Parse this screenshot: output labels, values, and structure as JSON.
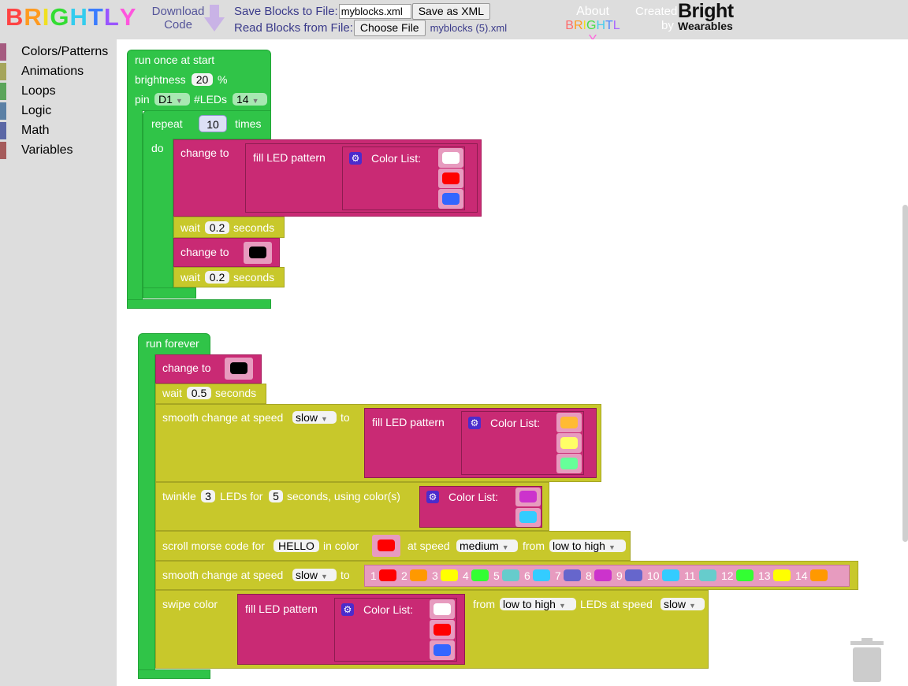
{
  "header": {
    "logo_letters": [
      {
        "ch": "B",
        "color": "#ff4444"
      },
      {
        "ch": "R",
        "color": "#ff9a1f"
      },
      {
        "ch": "I",
        "color": "#f0e020"
      },
      {
        "ch": "G",
        "color": "#33dd33"
      },
      {
        "ch": "H",
        "color": "#33ccee"
      },
      {
        "ch": "T",
        "color": "#3a7cff"
      },
      {
        "ch": "L",
        "color": "#9a55ff"
      },
      {
        "ch": "Y",
        "color": "#ff55dd"
      }
    ],
    "download_line1": "Download",
    "download_line2": "Code",
    "save_label": "Save Blocks to File:",
    "filename_value": "myblocks.xml",
    "save_button": "Save as XML",
    "read_label": "Read Blocks from File:",
    "choose_button": "Choose File",
    "chosen_file": "myblocks (5).xml",
    "about_line1": "About",
    "about_letters": [
      {
        "ch": "B",
        "color": "#ff6b6b"
      },
      {
        "ch": "R",
        "color": "#ff9a1f"
      },
      {
        "ch": "I",
        "color": "#f0e020"
      },
      {
        "ch": "G",
        "color": "#44dd44"
      },
      {
        "ch": "H",
        "color": "#44ccee"
      },
      {
        "ch": "T",
        "color": "#4a88ff"
      },
      {
        "ch": "L",
        "color": "#aa66ff"
      },
      {
        "ch": "Y",
        "color": "#ff66dd"
      }
    ],
    "created_line1": "Created",
    "created_line2": "by",
    "brand_line1": "Bright",
    "brand_line2": "Wearables"
  },
  "toolbox": {
    "categories": [
      {
        "label": "Colors/Patterns",
        "color": "#a55b80"
      },
      {
        "label": "Animations",
        "color": "#a5a55b"
      },
      {
        "label": "Loops",
        "color": "#5ba55b"
      },
      {
        "label": "Logic",
        "color": "#5b80a5"
      },
      {
        "label": "Math",
        "color": "#5b67a5"
      },
      {
        "label": "Variables",
        "color": "#a55b5b"
      }
    ]
  },
  "start": {
    "title": "run once at start",
    "brightness_label": "brightness",
    "brightness_value": "20",
    "percent": "%",
    "pin_label": "pin",
    "pin_value": "D1",
    "leds_label": "#LEDs",
    "leds_value": "14",
    "repeat_label": "repeat",
    "repeat_value": "10",
    "times_label": "times",
    "do_label": "do",
    "change_to_label": "change to",
    "fill_label": "fill LED pattern",
    "color_list_label": "Color List:",
    "fill_colors": [
      "#ffffff",
      "#ff0000",
      "#3366ff"
    ],
    "wait_label": "wait",
    "wait1_value": "0.2",
    "seconds_label": "seconds",
    "change2_color": "#000000",
    "wait2_value": "0.2"
  },
  "forever": {
    "title": "run forever",
    "change_to_label": "change to",
    "change_color": "#000000",
    "wait_label": "wait",
    "wait_value": "0.5",
    "seconds_label": "seconds",
    "smooth_label": "smooth change at speed",
    "smooth_speed": "slow",
    "to_label": "to",
    "fill_label": "fill LED pattern",
    "color_list_label": "Color List:",
    "smooth_colors": [
      "#ffbb33",
      "#ffff66",
      "#66ff99"
    ],
    "twinkle_label1": "twinkle",
    "twinkle_count": "3",
    "twinkle_label2": "LEDs for",
    "twinkle_secs": "5",
    "twinkle_label3": "seconds, using color(s)",
    "twinkle_colors": [
      "#cc33cc",
      "#33ccff"
    ],
    "morse_label": "scroll morse code for",
    "morse_text": "HELLO",
    "morse_in_color": "in color",
    "morse_color": "#ff0000",
    "at_speed_label": "at speed",
    "morse_speed": "medium",
    "from_label": "from",
    "morse_dir": "low to high",
    "smooth2_label": "smooth change at speed",
    "smooth2_speed": "slow",
    "smooth2_to": "to",
    "led_list": [
      {
        "n": "1",
        "color": "#ff0000"
      },
      {
        "n": "2",
        "color": "#ff9900"
      },
      {
        "n": "3",
        "color": "#ffff00"
      },
      {
        "n": "4",
        "color": "#33ff33"
      },
      {
        "n": "5",
        "color": "#66cccc"
      },
      {
        "n": "6",
        "color": "#33ccff"
      },
      {
        "n": "7",
        "color": "#6666cc"
      },
      {
        "n": "8",
        "color": "#cc33cc"
      },
      {
        "n": "9",
        "color": "#6666cc"
      },
      {
        "n": "10",
        "color": "#33ccff"
      },
      {
        "n": "11",
        "color": "#66cccc"
      },
      {
        "n": "12",
        "color": "#33ff33"
      },
      {
        "n": "13",
        "color": "#ffff00"
      },
      {
        "n": "14",
        "color": "#ff9900"
      }
    ],
    "swipe_label": "swipe color",
    "swipe_colors": [
      "#ffffff",
      "#ff0000",
      "#3366ff"
    ],
    "swipe_from": "from",
    "swipe_dir": "low to high",
    "swipe_speed_label": "LEDs at speed",
    "swipe_speed": "slow"
  }
}
